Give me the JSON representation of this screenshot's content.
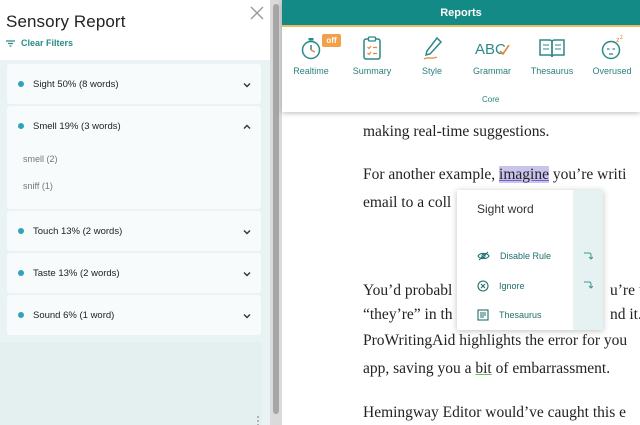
{
  "sidebar": {
    "title": "Sensory Report",
    "clear_filters": "Clear Filters",
    "senses": [
      {
        "label": "Sight 50% (8 words)",
        "expanded": false,
        "words": []
      },
      {
        "label": "Smell 19% (3 words)",
        "expanded": true,
        "words": [
          "smell (2)",
          "sniff (1)"
        ]
      },
      {
        "label": "Touch 13% (2 words)",
        "expanded": false,
        "words": []
      },
      {
        "label": "Taste 13% (2 words)",
        "expanded": false,
        "words": []
      },
      {
        "label": "Sound 6% (1 word)",
        "expanded": false,
        "words": []
      }
    ]
  },
  "toolbar": {
    "title": "Reports",
    "group_label": "Core",
    "realtime_badge": "off",
    "tools": [
      {
        "label": "Realtime",
        "icon": "stopwatch-icon"
      },
      {
        "label": "Summary",
        "icon": "clipboard-icon"
      },
      {
        "label": "Style",
        "icon": "pen-icon"
      },
      {
        "label": "Grammar",
        "icon": "abc-check-icon"
      },
      {
        "label": "Thesaurus",
        "icon": "book-icon"
      },
      {
        "label": "Overused",
        "icon": "sleepy-face-icon"
      }
    ]
  },
  "document": {
    "line1": "making real-time suggestions.",
    "line2_pre": "For another example, ",
    "line2_highlight": "imagine",
    "line2_post": " you’re writi",
    "line3": "email to a coll",
    "line4_pre": "You’d probabl",
    "line4_post": "u’re us",
    "line5_pre": "“they’re” in th",
    "line5_post": "nd it. I",
    "line6": "ProWritingAid highlights the error for you",
    "line7_pre": "app, saving you a ",
    "line7_underlined": "bit",
    "line7_post": " of embarrassment.",
    "line8": "Hemingway Editor would’ve caught this e"
  },
  "popup": {
    "title": "Sight word",
    "disable_rule": "Disable Rule",
    "ignore": "Ignore",
    "thesaurus": "Thesaurus"
  },
  "colors": {
    "accent_teal": "#138a85",
    "highlight": "#c9c4ee",
    "badge_orange": "#f2a14a",
    "sense_dot": "#2ea3bb"
  }
}
